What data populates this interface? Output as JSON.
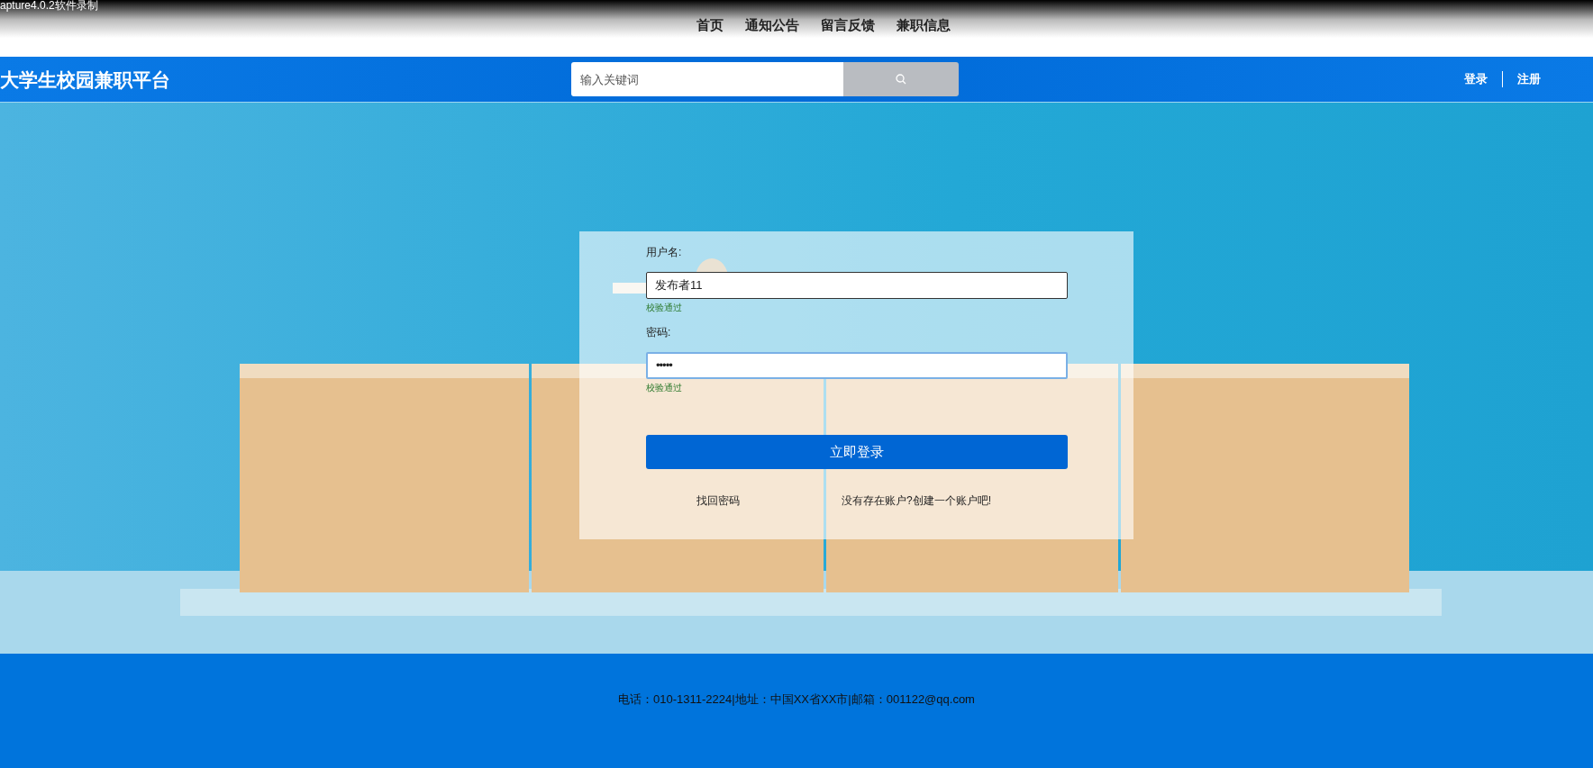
{
  "recorder_caption": "apture4.0.2软件录制",
  "nav": [
    {
      "label": "首页"
    },
    {
      "label": "通知公告"
    },
    {
      "label": "留言反馈"
    },
    {
      "label": "兼职信息"
    }
  ],
  "brand": "大学生校园兼职平台",
  "search": {
    "placeholder": "输入关键词"
  },
  "auth_links": [
    "登录",
    "注册"
  ],
  "login_form": {
    "fields": [
      {
        "label": "用户名:",
        "value": "发布者11",
        "kind": "text",
        "focused": false,
        "hint": "校验通过"
      },
      {
        "label": "密码:",
        "value": "•••••",
        "kind": "password",
        "focused": true,
        "hint": "校验通过"
      }
    ],
    "submit": "立即登录",
    "links": [
      "找回密码",
      "没有存在账户?创建一个账户吧!"
    ]
  },
  "footer": "电话：010-1311-2224|地址：中国XX省XX市|邮箱：001122@qq.com"
}
